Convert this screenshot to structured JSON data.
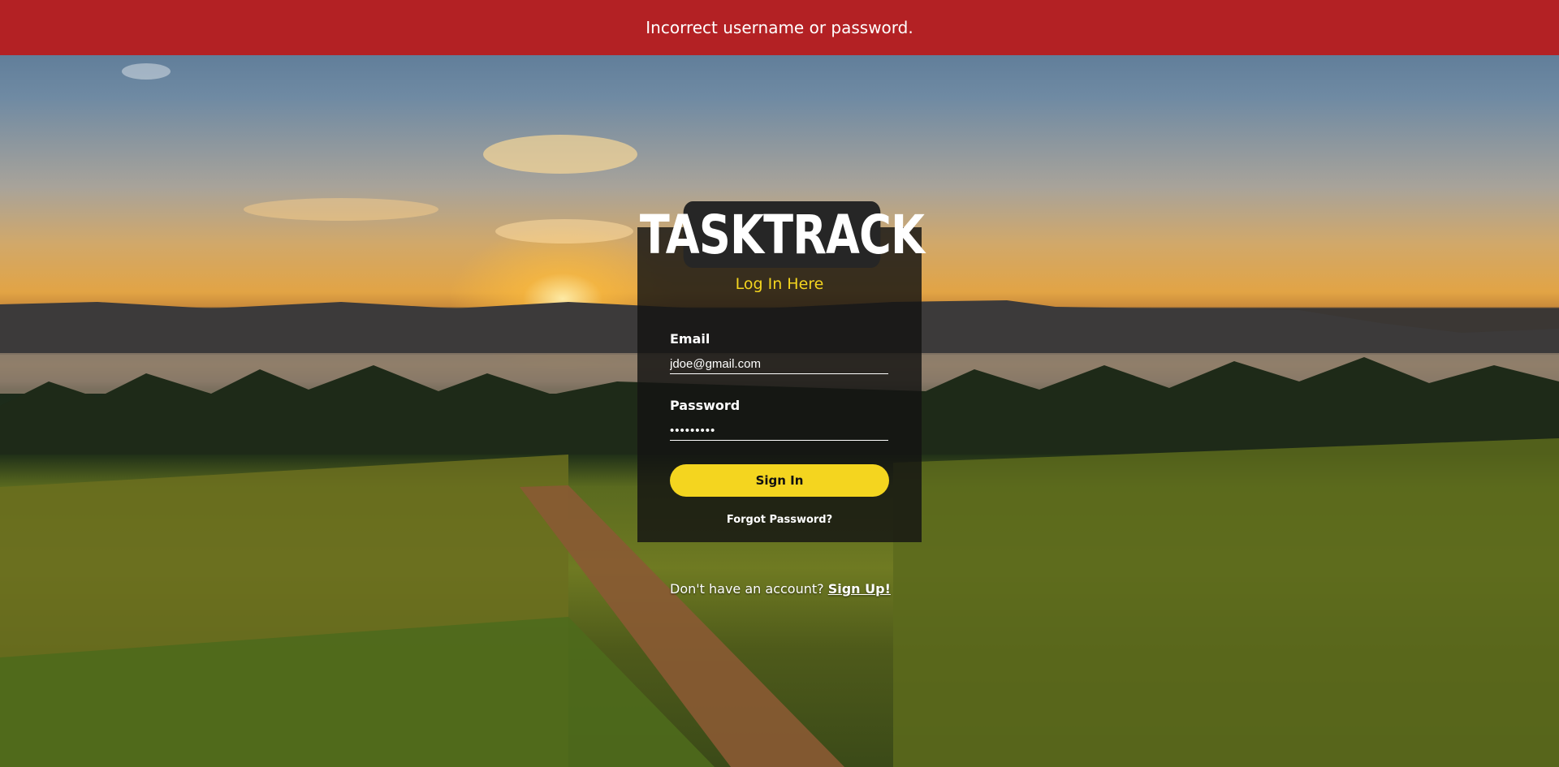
{
  "alert": {
    "message": "Incorrect username or password."
  },
  "brand": {
    "logo_text": "TASKTRACK"
  },
  "login": {
    "title": "Log In Here",
    "email_label": "Email",
    "email_value": "jdoe@gmail.com",
    "password_label": "Password",
    "password_value": "•••••••••",
    "signin_label": "Sign In",
    "forgot_label": "Forgot Password?"
  },
  "signup": {
    "prompt": "Don't have an account?",
    "link_label": "Sign Up!"
  },
  "colors": {
    "alert_bg": "#b32124",
    "accent": "#f4d51f",
    "card_bg": "rgba(20,20,18,0.82)"
  }
}
